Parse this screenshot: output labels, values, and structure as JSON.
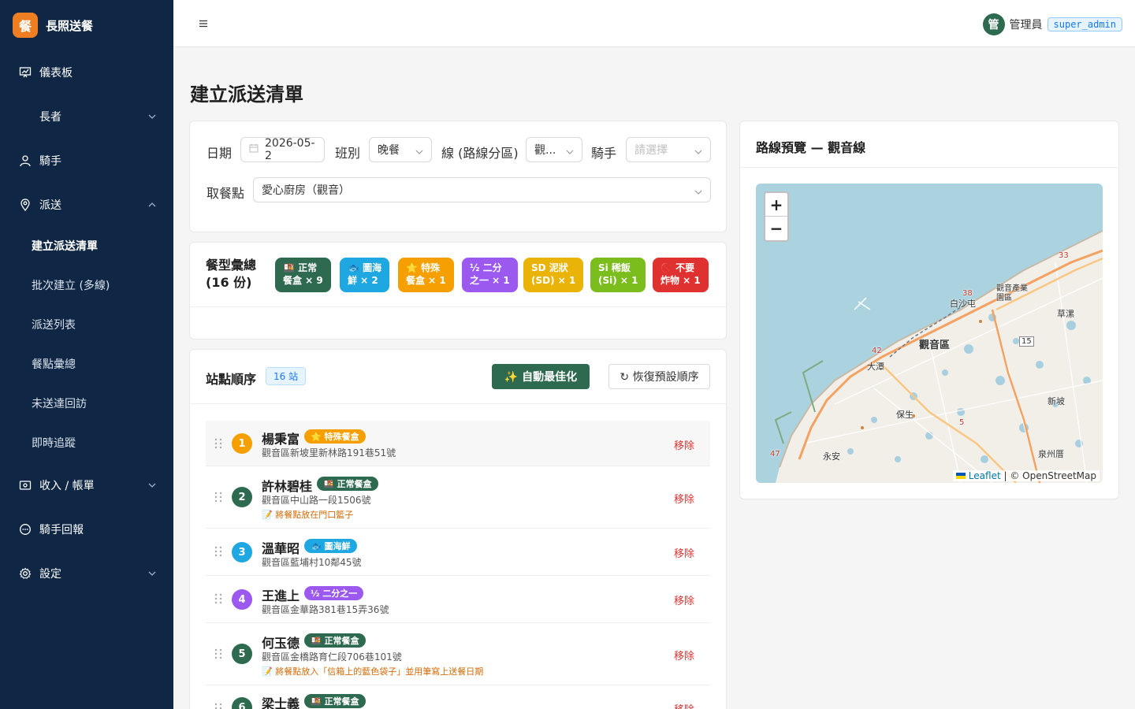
{
  "brand": {
    "logo": "餐",
    "title": "長照送餐"
  },
  "sidebar": {
    "items": [
      {
        "label": "儀表板",
        "icon": "dashboard-icon"
      },
      {
        "label": "長者"
      },
      {
        "label": "騎手",
        "icon": "user-icon"
      },
      {
        "label": "派送",
        "icon": "location-icon"
      },
      {
        "label": "收入 / 帳單",
        "icon": "wallet-icon"
      },
      {
        "label": "騎手回報",
        "icon": "message-icon"
      },
      {
        "label": "設定",
        "icon": "gear-icon"
      }
    ],
    "dispatch_sub": [
      "建立派送清單",
      "批次建立 (多線)",
      "派送列表",
      "餐點彙總",
      "未送達回訪",
      "即時追蹤"
    ]
  },
  "header": {
    "avatar": "管",
    "user_name": "管理員",
    "role": "super_admin"
  },
  "page": {
    "title": "建立派送清單"
  },
  "filters": {
    "date_label": "日期",
    "date_value": "2026-05-2",
    "shift_label": "班別",
    "shift_value": "晚餐",
    "line_label": "線 (路線分區)",
    "line_value": "觀...",
    "rider_label": "騎手",
    "rider_placeholder": "請選擇",
    "pickup_label": "取餐點",
    "pickup_value": "愛心廚房（觀音）"
  },
  "meal_summary": {
    "title": "餐型彙總",
    "count": "(16 份)",
    "badges": [
      {
        "line1": "🍱 正常",
        "line2": "餐盒 × 9",
        "color": "#2d6a4f"
      },
      {
        "line1": "🐟 圖海",
        "line2": "鮮 × 2",
        "color": "#1ea7e1"
      },
      {
        "line1": "⭐ 特殊",
        "line2": "餐盒 × 1",
        "color": "#f59f00"
      },
      {
        "line1": "½ 二分",
        "line2": "之一 × 1",
        "color": "#9b59f0"
      },
      {
        "line1": "SD 泥狀",
        "line2": "(SD) × 1",
        "color": "#eab308"
      },
      {
        "line1": "Si 稀飯",
        "line2": "(Si) × 1",
        "color": "#7cbd1e"
      },
      {
        "line1": "🚫 不要",
        "line2": "炸物 × 1",
        "color": "#e03131"
      }
    ]
  },
  "stops": {
    "title": "站點順序",
    "count": "16 站",
    "optimize_label": "✨ 自動最佳化",
    "reset_label": "↻ 恢復預設順序",
    "remove_label": "移除",
    "rows": [
      {
        "n": "1",
        "name": "楊秉富",
        "tag": "⭐ 特殊餐盒",
        "tag_color": "#f59f00",
        "num_color": "#f59f00",
        "addr": "觀音區新坡里新林路191巷51號",
        "note": ""
      },
      {
        "n": "2",
        "name": "許林碧桂",
        "tag": "🍱 正常餐盒",
        "tag_color": "#2d6a4f",
        "num_color": "#2d6a4f",
        "addr": "觀音區中山路一段1506號",
        "note": "📝 將餐點放在門口籃子"
      },
      {
        "n": "3",
        "name": "溫華昭",
        "tag": "🐟 圖海鮮",
        "tag_color": "#1ea7e1",
        "num_color": "#1ea7e1",
        "addr": "觀音區藍埔村10鄰45號",
        "note": ""
      },
      {
        "n": "4",
        "name": "王進上",
        "tag": "½ 二分之一",
        "tag_color": "#9b59f0",
        "num_color": "#9b59f0",
        "addr": "觀音區金華路381巷15弄36號",
        "note": ""
      },
      {
        "n": "5",
        "name": "何玉德",
        "tag": "🍱 正常餐盒",
        "tag_color": "#2d6a4f",
        "num_color": "#2d6a4f",
        "addr": "觀音區金橋路育仁段706巷101號",
        "note": "📝 將餐點放入「信箱上的藍色袋子」並用筆寫上送餐日期"
      },
      {
        "n": "6",
        "name": "梁士義",
        "tag": "🍱 正常餐盒",
        "tag_color": "#2d6a4f",
        "num_color": "#2d6a4f",
        "addr": "",
        "note": ""
      }
    ]
  },
  "map": {
    "title": "路線預覽 — 觀音線",
    "zoom_in": "+",
    "zoom_out": "−",
    "attrib_leaflet": "Leaflet",
    "attrib_osm": "| © OpenStreetMap",
    "places": [
      "白沙屯",
      "觀音產業園區",
      "觀音區",
      "草漯",
      "大潭",
      "保生",
      "新坡",
      "永安",
      "泉州厝"
    ],
    "road_numbers": [
      "33",
      "38",
      "42",
      "15",
      "5",
      "47"
    ]
  }
}
